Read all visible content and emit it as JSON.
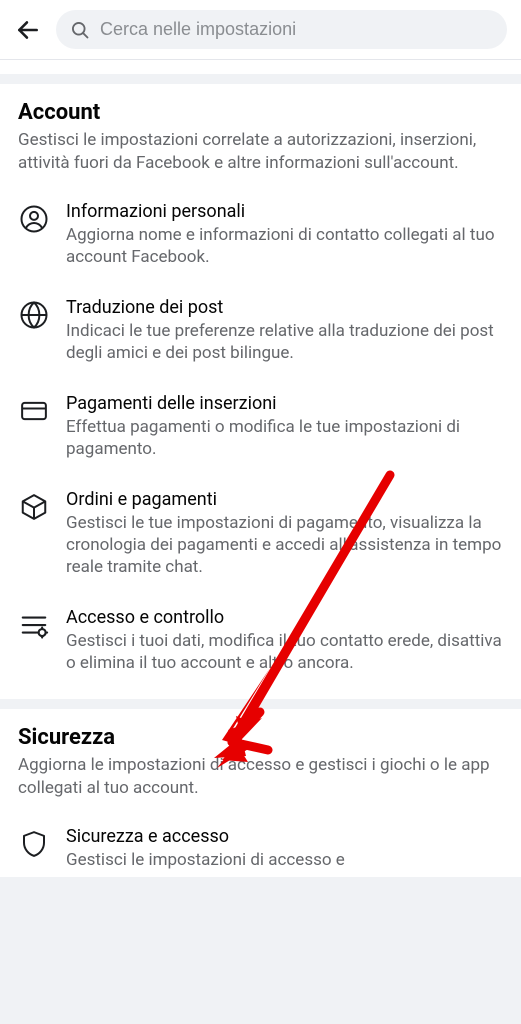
{
  "search": {
    "placeholder": "Cerca nelle impostazioni"
  },
  "sections": {
    "account": {
      "title": "Account",
      "description": "Gestisci le impostazioni correlate a autorizzazioni, inserzioni, attività fuori da Facebook e altre informazioni sull'account.",
      "items": [
        {
          "title": "Informazioni personali",
          "description": "Aggiorna nome e informazioni di contatto collegati al tuo account Facebook."
        },
        {
          "title": "Traduzione dei post",
          "description": "Indicaci le tue preferenze relative alla traduzione dei post degli amici e dei post bilingue."
        },
        {
          "title": "Pagamenti delle inserzioni",
          "description": "Effettua pagamenti o modifica le tue impostazioni di pagamento."
        },
        {
          "title": "Ordini e pagamenti",
          "description": "Gestisci le tue impostazioni di pagamento, visualizza la cronologia dei pagamenti e accedi all'assistenza in tempo reale tramite chat."
        },
        {
          "title": "Accesso e controllo",
          "description": "Gestisci i tuoi dati, modifica il tuo contatto erede, disattiva o elimina il tuo account e altro ancora."
        }
      ]
    },
    "security": {
      "title": "Sicurezza",
      "description": "Aggiorna le impostazioni di accesso e gestisci i giochi o le app collegati al tuo account.",
      "items": [
        {
          "title": "Sicurezza e accesso",
          "description": "Gestisci le impostazioni di accesso e"
        }
      ]
    }
  }
}
